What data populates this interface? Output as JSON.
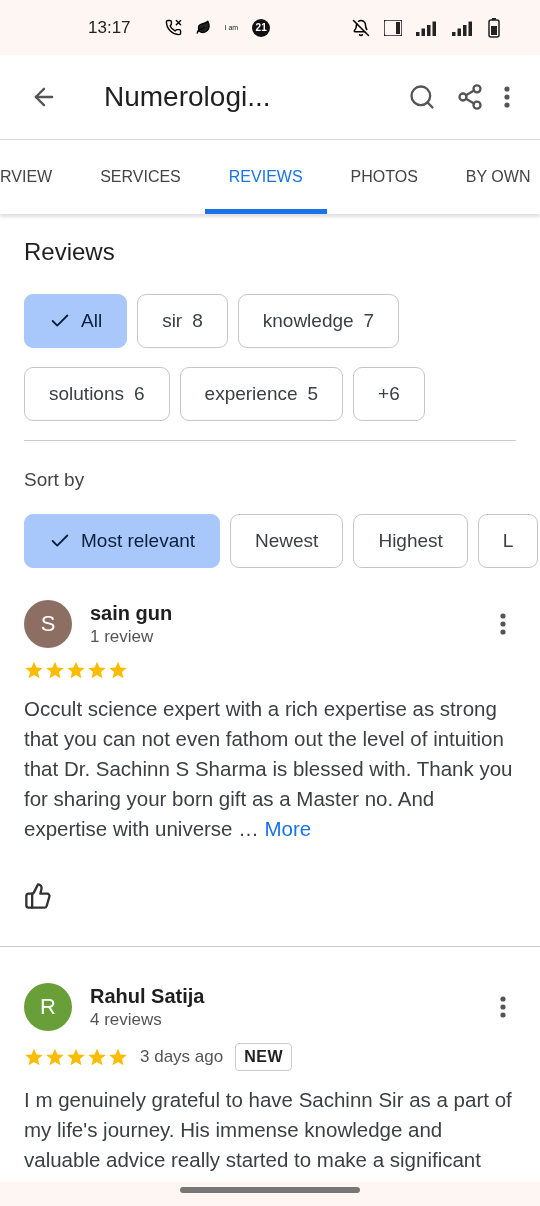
{
  "status_bar": {
    "time": "13:17",
    "notification_text": "I am",
    "badge": "21"
  },
  "toolbar": {
    "title": "Numerologi..."
  },
  "tabs": [
    {
      "label": "RVIEW",
      "selected": false
    },
    {
      "label": "SERVICES",
      "selected": false
    },
    {
      "label": "REVIEWS",
      "selected": true
    },
    {
      "label": "PHOTOS",
      "selected": false
    },
    {
      "label": "BY OWN",
      "selected": false
    }
  ],
  "section_title": "Reviews",
  "topic_chips": [
    {
      "label": "All",
      "selected": true
    },
    {
      "label": "sir",
      "count": "8",
      "selected": false
    },
    {
      "label": "knowledge",
      "count": "7",
      "selected": false
    },
    {
      "label": "solutions",
      "count": "6",
      "selected": false
    },
    {
      "label": "experience",
      "count": "5",
      "selected": false
    },
    {
      "label": "+6",
      "selected": false
    }
  ],
  "sort_label": "Sort by",
  "sort_chips": [
    {
      "label": "Most relevant",
      "selected": true
    },
    {
      "label": "Newest",
      "selected": false
    },
    {
      "label": "Highest",
      "selected": false
    },
    {
      "label": "L",
      "selected": false
    }
  ],
  "reviews": [
    {
      "initial": "S",
      "color": "#8d6e63",
      "name": "sain gun",
      "count": "1 review",
      "stars": 5,
      "text": "Occult science expert with a rich expertise as strong that you can not even fathom out the level of intuition that Dr. Sachinn S Sharma is blessed with. Thank you for sharing your born gift as a Master no. And expertise with universe …",
      "more": "More",
      "like": true
    },
    {
      "initial": "R",
      "color": "#689f38",
      "name": "Rahul Satija",
      "count": "4 reviews",
      "stars": 5,
      "time": "3 days ago",
      "badge": "NEW",
      "text": "I m genuinely grateful to have Sachinn Sir as a part of my life's journey. His immense knowledge and valuable advice really started to make a significant",
      "like": false
    }
  ]
}
